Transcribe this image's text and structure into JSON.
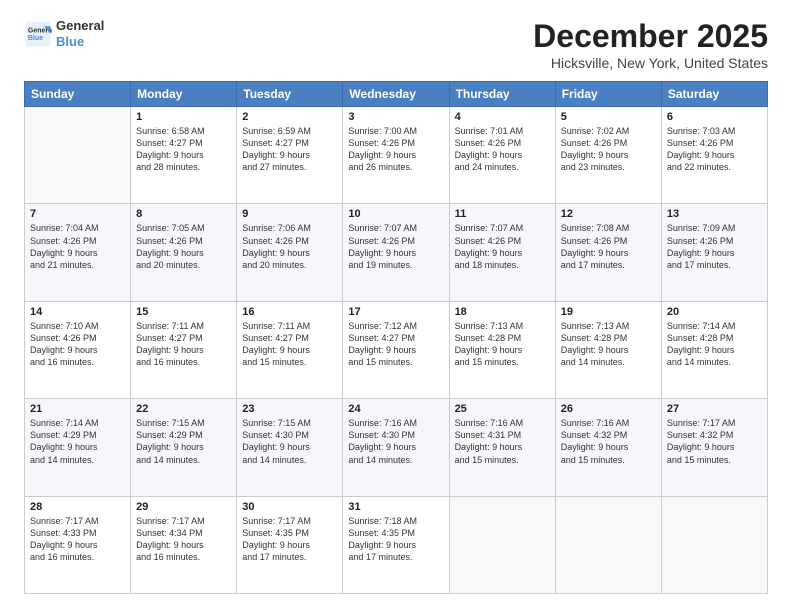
{
  "header": {
    "logo_line1": "General",
    "logo_line2": "Blue",
    "month_title": "December 2025",
    "location": "Hicksville, New York, United States"
  },
  "weekdays": [
    "Sunday",
    "Monday",
    "Tuesday",
    "Wednesday",
    "Thursday",
    "Friday",
    "Saturday"
  ],
  "weeks": [
    [
      {
        "day": "",
        "info": ""
      },
      {
        "day": "1",
        "info": "Sunrise: 6:58 AM\nSunset: 4:27 PM\nDaylight: 9 hours\nand 28 minutes."
      },
      {
        "day": "2",
        "info": "Sunrise: 6:59 AM\nSunset: 4:27 PM\nDaylight: 9 hours\nand 27 minutes."
      },
      {
        "day": "3",
        "info": "Sunrise: 7:00 AM\nSunset: 4:26 PM\nDaylight: 9 hours\nand 26 minutes."
      },
      {
        "day": "4",
        "info": "Sunrise: 7:01 AM\nSunset: 4:26 PM\nDaylight: 9 hours\nand 24 minutes."
      },
      {
        "day": "5",
        "info": "Sunrise: 7:02 AM\nSunset: 4:26 PM\nDaylight: 9 hours\nand 23 minutes."
      },
      {
        "day": "6",
        "info": "Sunrise: 7:03 AM\nSunset: 4:26 PM\nDaylight: 9 hours\nand 22 minutes."
      }
    ],
    [
      {
        "day": "7",
        "info": "Sunrise: 7:04 AM\nSunset: 4:26 PM\nDaylight: 9 hours\nand 21 minutes."
      },
      {
        "day": "8",
        "info": "Sunrise: 7:05 AM\nSunset: 4:26 PM\nDaylight: 9 hours\nand 20 minutes."
      },
      {
        "day": "9",
        "info": "Sunrise: 7:06 AM\nSunset: 4:26 PM\nDaylight: 9 hours\nand 20 minutes."
      },
      {
        "day": "10",
        "info": "Sunrise: 7:07 AM\nSunset: 4:26 PM\nDaylight: 9 hours\nand 19 minutes."
      },
      {
        "day": "11",
        "info": "Sunrise: 7:07 AM\nSunset: 4:26 PM\nDaylight: 9 hours\nand 18 minutes."
      },
      {
        "day": "12",
        "info": "Sunrise: 7:08 AM\nSunset: 4:26 PM\nDaylight: 9 hours\nand 17 minutes."
      },
      {
        "day": "13",
        "info": "Sunrise: 7:09 AM\nSunset: 4:26 PM\nDaylight: 9 hours\nand 17 minutes."
      }
    ],
    [
      {
        "day": "14",
        "info": "Sunrise: 7:10 AM\nSunset: 4:26 PM\nDaylight: 9 hours\nand 16 minutes."
      },
      {
        "day": "15",
        "info": "Sunrise: 7:11 AM\nSunset: 4:27 PM\nDaylight: 9 hours\nand 16 minutes."
      },
      {
        "day": "16",
        "info": "Sunrise: 7:11 AM\nSunset: 4:27 PM\nDaylight: 9 hours\nand 15 minutes."
      },
      {
        "day": "17",
        "info": "Sunrise: 7:12 AM\nSunset: 4:27 PM\nDaylight: 9 hours\nand 15 minutes."
      },
      {
        "day": "18",
        "info": "Sunrise: 7:13 AM\nSunset: 4:28 PM\nDaylight: 9 hours\nand 15 minutes."
      },
      {
        "day": "19",
        "info": "Sunrise: 7:13 AM\nSunset: 4:28 PM\nDaylight: 9 hours\nand 14 minutes."
      },
      {
        "day": "20",
        "info": "Sunrise: 7:14 AM\nSunset: 4:28 PM\nDaylight: 9 hours\nand 14 minutes."
      }
    ],
    [
      {
        "day": "21",
        "info": "Sunrise: 7:14 AM\nSunset: 4:29 PM\nDaylight: 9 hours\nand 14 minutes."
      },
      {
        "day": "22",
        "info": "Sunrise: 7:15 AM\nSunset: 4:29 PM\nDaylight: 9 hours\nand 14 minutes."
      },
      {
        "day": "23",
        "info": "Sunrise: 7:15 AM\nSunset: 4:30 PM\nDaylight: 9 hours\nand 14 minutes."
      },
      {
        "day": "24",
        "info": "Sunrise: 7:16 AM\nSunset: 4:30 PM\nDaylight: 9 hours\nand 14 minutes."
      },
      {
        "day": "25",
        "info": "Sunrise: 7:16 AM\nSunset: 4:31 PM\nDaylight: 9 hours\nand 15 minutes."
      },
      {
        "day": "26",
        "info": "Sunrise: 7:16 AM\nSunset: 4:32 PM\nDaylight: 9 hours\nand 15 minutes."
      },
      {
        "day": "27",
        "info": "Sunrise: 7:17 AM\nSunset: 4:32 PM\nDaylight: 9 hours\nand 15 minutes."
      }
    ],
    [
      {
        "day": "28",
        "info": "Sunrise: 7:17 AM\nSunset: 4:33 PM\nDaylight: 9 hours\nand 16 minutes."
      },
      {
        "day": "29",
        "info": "Sunrise: 7:17 AM\nSunset: 4:34 PM\nDaylight: 9 hours\nand 16 minutes."
      },
      {
        "day": "30",
        "info": "Sunrise: 7:17 AM\nSunset: 4:35 PM\nDaylight: 9 hours\nand 17 minutes."
      },
      {
        "day": "31",
        "info": "Sunrise: 7:18 AM\nSunset: 4:35 PM\nDaylight: 9 hours\nand 17 minutes."
      },
      {
        "day": "",
        "info": ""
      },
      {
        "day": "",
        "info": ""
      },
      {
        "day": "",
        "info": ""
      }
    ]
  ]
}
